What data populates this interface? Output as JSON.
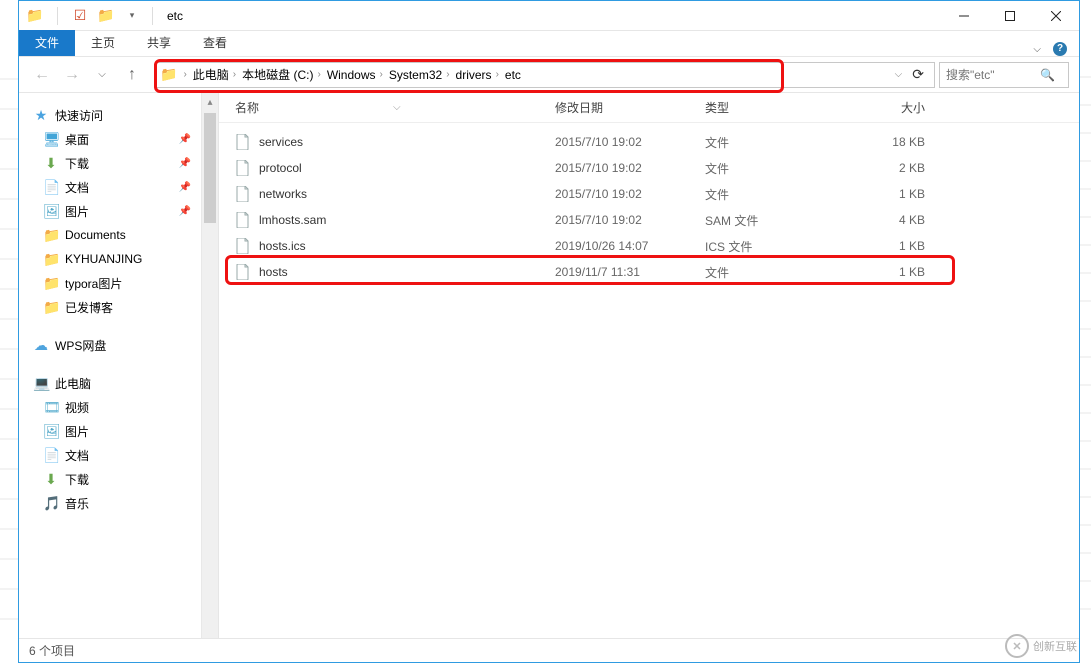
{
  "window": {
    "title": "etc"
  },
  "ribbon": {
    "file": "文件",
    "home": "主页",
    "share": "共享",
    "view": "查看"
  },
  "breadcrumb": [
    "此电脑",
    "本地磁盘 (C:)",
    "Windows",
    "System32",
    "drivers",
    "etc"
  ],
  "search": {
    "placeholder": "搜索\"etc\""
  },
  "sidebar": {
    "quick_access": "快速访问",
    "desktop": "桌面",
    "downloads": "下载",
    "documents": "文档",
    "pictures": "图片",
    "docs_folder": "Documents",
    "ky": "KYHUANJING",
    "typora": "typora图片",
    "blog": "已发博客",
    "wps": "WPS网盘",
    "this_pc": "此电脑",
    "video": "视频",
    "pic2": "图片",
    "doc2": "文档",
    "dl2": "下载",
    "music": "音乐"
  },
  "columns": {
    "name": "名称",
    "date": "修改日期",
    "type": "类型",
    "size": "大小"
  },
  "files": [
    {
      "name": "services",
      "date": "2015/7/10 19:02",
      "type": "文件",
      "size": "18 KB"
    },
    {
      "name": "protocol",
      "date": "2015/7/10 19:02",
      "type": "文件",
      "size": "2 KB"
    },
    {
      "name": "networks",
      "date": "2015/7/10 19:02",
      "type": "文件",
      "size": "1 KB"
    },
    {
      "name": "lmhosts.sam",
      "date": "2015/7/10 19:02",
      "type": "SAM 文件",
      "size": "4 KB"
    },
    {
      "name": "hosts.ics",
      "date": "2019/10/26 14:07",
      "type": "ICS 文件",
      "size": "1 KB"
    },
    {
      "name": "hosts",
      "date": "2019/11/7 11:31",
      "type": "文件",
      "size": "1 KB"
    }
  ],
  "status": {
    "items_label": "6 个项目"
  },
  "watermark": "创新互联"
}
